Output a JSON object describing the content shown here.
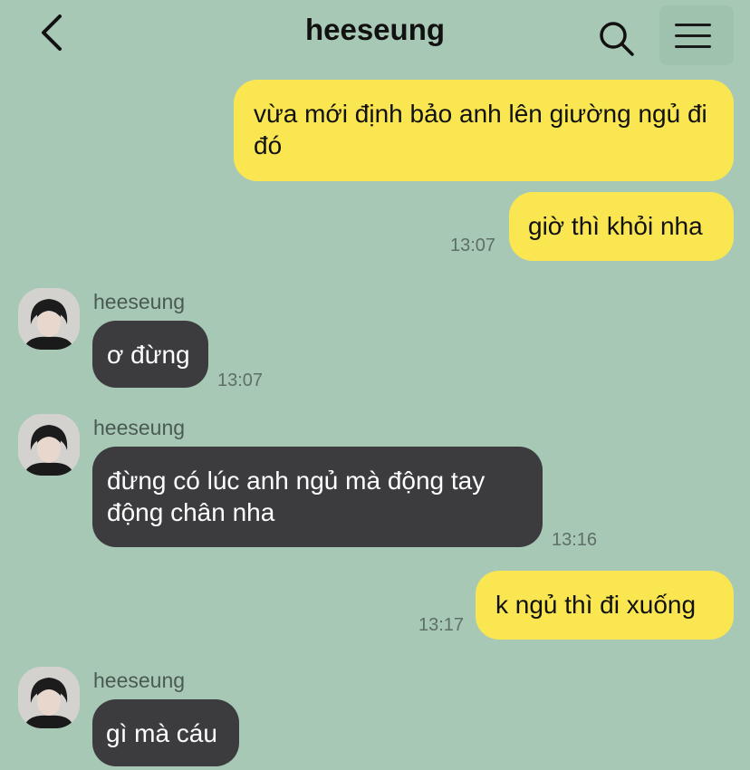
{
  "header": {
    "title": "heeseung"
  },
  "messages": [
    {
      "text": "vừa mới định bảo anh lên giường ngủ đi đó"
    },
    {
      "text": "giờ thì khỏi nha",
      "time": "13:07"
    },
    {
      "sender": "heeseung",
      "text": "ơ đừng",
      "time": "13:07"
    },
    {
      "sender": "heeseung",
      "text": "đừng có lúc anh ngủ mà động tay động chân nha",
      "time": "13:16"
    },
    {
      "text": "k ngủ thì đi xuống",
      "time": "13:17"
    },
    {
      "sender": "heeseung",
      "text": "gì mà cáu"
    }
  ],
  "colors": {
    "background": "#a8c8b6",
    "outgoing": "#fae650",
    "incoming": "#3c3c3f"
  },
  "icons": [
    "back-chevron-icon",
    "search-icon",
    "menu-icon"
  ]
}
